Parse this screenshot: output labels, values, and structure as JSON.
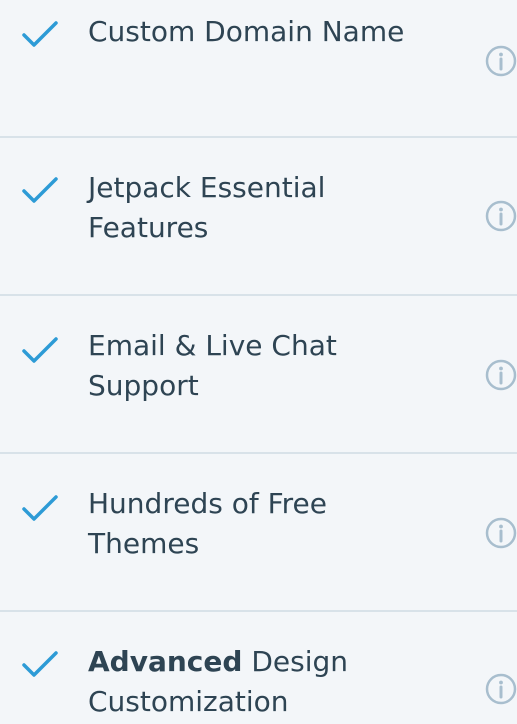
{
  "features": [
    {
      "label": "Custom Domain Name",
      "emphasis": "",
      "rest": "",
      "icon": "check-icon",
      "info_icon": "info-icon"
    },
    {
      "label": "Jetpack Essential Features",
      "emphasis": "",
      "rest": "",
      "icon": "check-icon",
      "info_icon": "info-icon"
    },
    {
      "label": "Email & Live Chat Support",
      "emphasis": "",
      "rest": "",
      "icon": "check-icon",
      "info_icon": "info-icon"
    },
    {
      "label": "Hundreds of Free Themes",
      "emphasis": "",
      "rest": "",
      "icon": "check-icon",
      "info_icon": "info-icon"
    },
    {
      "label": "",
      "emphasis": "Advanced",
      "rest": " Design Customization",
      "icon": "check-icon",
      "info_icon": "info-icon"
    }
  ],
  "colors": {
    "background": "#f3f6f9",
    "text": "#2e4453",
    "check": "#2d9bd6",
    "divider": "#d8e2e9",
    "info": "#a8bece"
  }
}
